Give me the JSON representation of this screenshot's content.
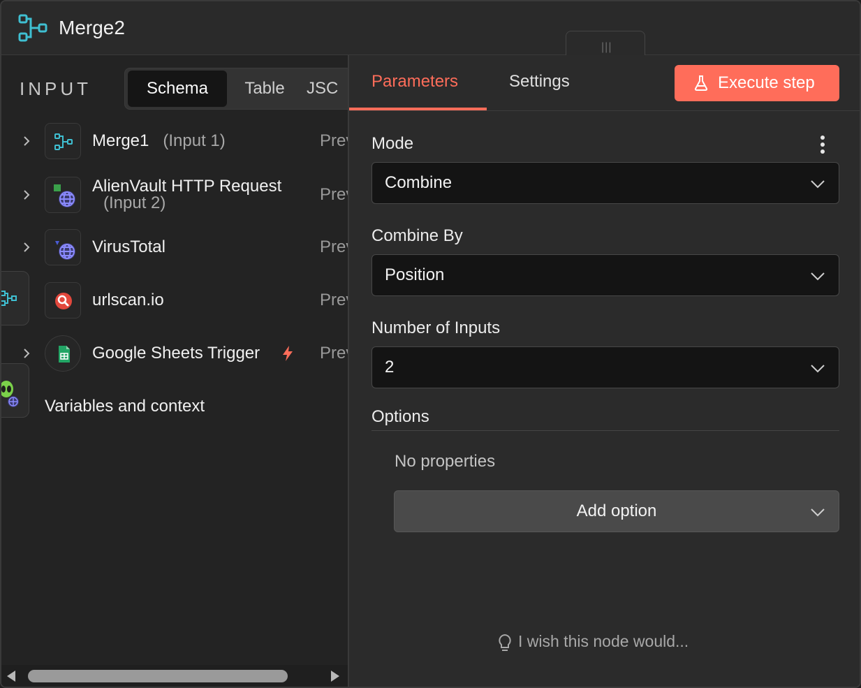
{
  "header": {
    "title": "Merge2",
    "icon": "merge-icon",
    "accent_color": "#3fbfd1"
  },
  "input_panel": {
    "label": "INPUT",
    "view_tabs": [
      {
        "label": "Schema",
        "active": true
      },
      {
        "label": "Table",
        "active": false
      },
      {
        "label": "JSC",
        "active": false
      }
    ],
    "nodes": [
      {
        "name": "Merge1",
        "sub": "(Input 1)",
        "preview": "Prev",
        "icon": "merge-icon"
      },
      {
        "name": "AlienVault HTTP Request",
        "sub": "(Input 2)",
        "preview": "Prev",
        "icon": "globe-icon"
      },
      {
        "name": "VirusTotal",
        "sub": "",
        "preview": "Prev",
        "icon": "globe-icon"
      },
      {
        "name": "urlscan.io",
        "sub": "",
        "preview": "Prev",
        "icon": "urlscan-icon"
      },
      {
        "name": "Google Sheets Trigger",
        "sub": "",
        "preview": "Prev",
        "icon": "google-sheets-icon",
        "trigger_icon": "lightning-icon"
      }
    ],
    "variables_label": "Variables and context"
  },
  "params_panel": {
    "tabs": [
      {
        "label": "Parameters",
        "active": true
      },
      {
        "label": "Settings",
        "active": false
      }
    ],
    "execute_label": "Execute step",
    "accent_color": "#ff6d5a",
    "fields": [
      {
        "label": "Mode",
        "value": "Combine"
      },
      {
        "label": "Combine By",
        "value": "Position"
      },
      {
        "label": "Number of Inputs",
        "value": "2"
      }
    ],
    "options": {
      "label": "Options",
      "empty_text": "No properties",
      "add_label": "Add option"
    },
    "feedback_label": "I wish this node would..."
  }
}
